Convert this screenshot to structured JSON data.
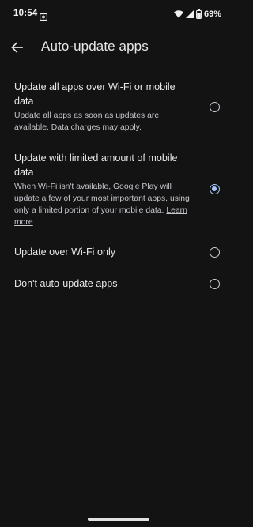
{
  "status_bar": {
    "time": "10:54",
    "battery_percent": "69%",
    "icons": [
      "cast-icon",
      "wifi-icon",
      "signal-icon",
      "battery-icon"
    ]
  },
  "app_bar": {
    "back_icon": "arrow-back-icon",
    "title": "Auto-update apps"
  },
  "options": [
    {
      "title": "Update all apps over Wi-Fi or mobile data",
      "description": "Update all apps as soon as updates are available. Data charges may apply.",
      "selected": false
    },
    {
      "title": "Update with limited amount of mobile data",
      "description": "When Wi-Fi isn't available, Google Play will update a few of your most important apps, using only a limited portion of your mobile data.",
      "link": "Learn more",
      "selected": true
    },
    {
      "title": "Update over Wi-Fi only",
      "selected": false
    },
    {
      "title": "Don't auto-update apps",
      "selected": false
    }
  ],
  "colors": {
    "background": "#131314",
    "accent": "#a8c7fa",
    "text_primary": "#e6e6e6",
    "text_secondary": "#c4c6cb"
  }
}
